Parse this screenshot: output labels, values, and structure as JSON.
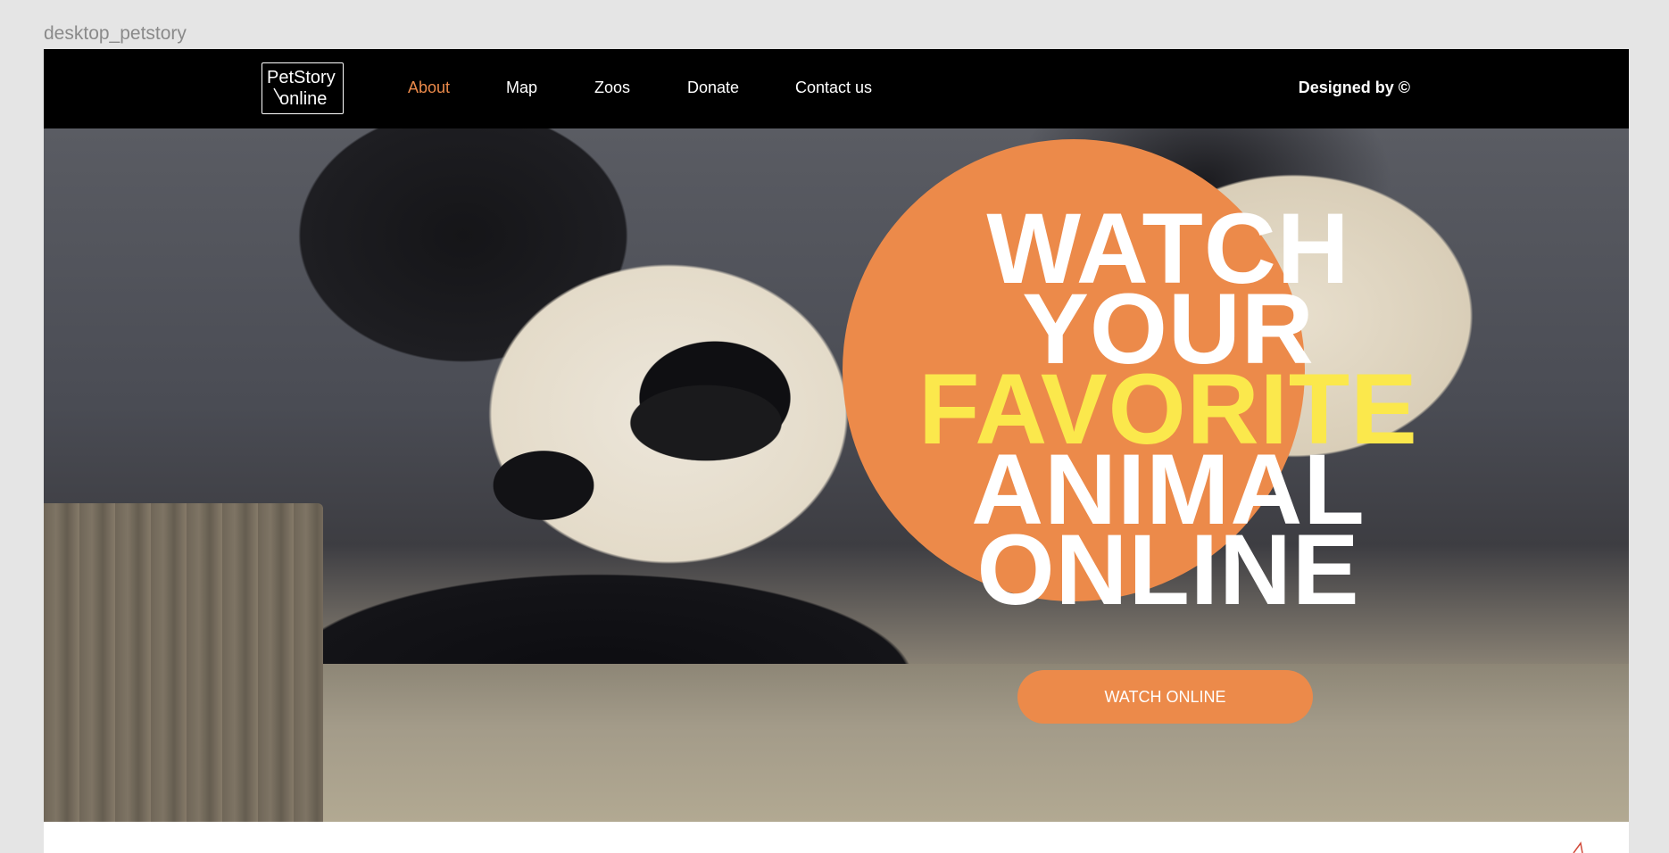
{
  "frame_label": "desktop_petstory",
  "header": {
    "logo_line1": "PetStory",
    "logo_line2": "online",
    "nav": [
      {
        "label": "About",
        "active": true
      },
      {
        "label": "Map",
        "active": false
      },
      {
        "label": "Zoos",
        "active": false
      },
      {
        "label": "Donate",
        "active": false
      },
      {
        "label": "Contact us",
        "active": false
      }
    ],
    "designed_by": "Designed by ©"
  },
  "hero": {
    "headline": [
      "WATCH",
      "YOUR",
      "FAVORITE",
      "ANIMAL",
      "ONLINE"
    ],
    "highlight_word": "FAVORITE",
    "button_label": "WATCH ONLINE"
  },
  "colors": {
    "accent": "#ec8a4a",
    "highlight": "#fbe84c",
    "header_bg": "#000000",
    "text_light": "#ffffff"
  }
}
